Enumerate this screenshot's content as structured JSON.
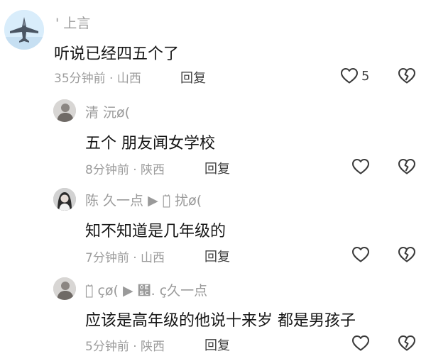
{
  "comments": [
    {
      "username": "' 上言",
      "content": "听说已经四五个了",
      "meta": "35分钟前 · 山西",
      "reply_label": "回复",
      "like_count": "5",
      "avatar": "fighter-jet-avatar"
    },
    {
      "username": "清   沅ø(",
      "content": "五个 朋友闻女学校",
      "meta": "8分钟前 · 陕西",
      "reply_label": "回复",
      "like_count": "",
      "avatar": "person-avatar"
    },
    {
      "username": "陈   久一点 ▶ 清̆ 扰ø(",
      "content": "知不知道是几年级的",
      "meta": "7分钟前 · 山西",
      "reply_label": "回复",
      "like_count": "",
      "avatar": "girl-avatar"
    },
    {
      "username": "清̆   çø( ▶ ๜.   ç久一点",
      "content": "应该是高年级的他说十来岁 都是男孩子",
      "meta": "5分钟前 · 陕西",
      "reply_label": "回复",
      "like_count": "",
      "avatar": "person-avatar"
    }
  ],
  "colors": {
    "content": "#161616",
    "meta": "#9c9c9c",
    "username": "#9a9a9a",
    "icon": "#3a3a3a"
  }
}
